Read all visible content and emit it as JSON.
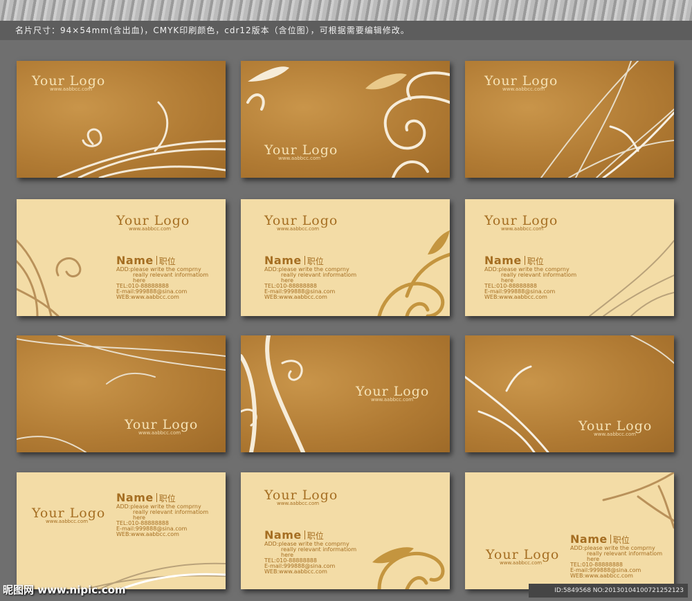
{
  "caption": "名片尺寸：94×54mm(含出血)，CMYK印刷颜色，cdr12版本（含位图），可根据需要编辑修改。",
  "card": {
    "logo": "Your Logo",
    "url": "www.aabbcc.com",
    "name": "Name",
    "position": "职位",
    "add1": "ADD:please write the comprny",
    "add2": "really relevant informatiom",
    "add3": "here",
    "tel": "TEL:010-88888888",
    "email": "E-mail:999888@sina.com",
    "web": "WEB:www.aabbcc.com"
  },
  "watermark": {
    "left": "昵图网 www.nipic.com",
    "right": "ID:5849568 NO:20130104100721252123"
  },
  "colors": {
    "dark_card": "#b07a33",
    "light_card": "#f3dca6",
    "text_gold": "#a56e22",
    "background": "#6f6f6f"
  }
}
